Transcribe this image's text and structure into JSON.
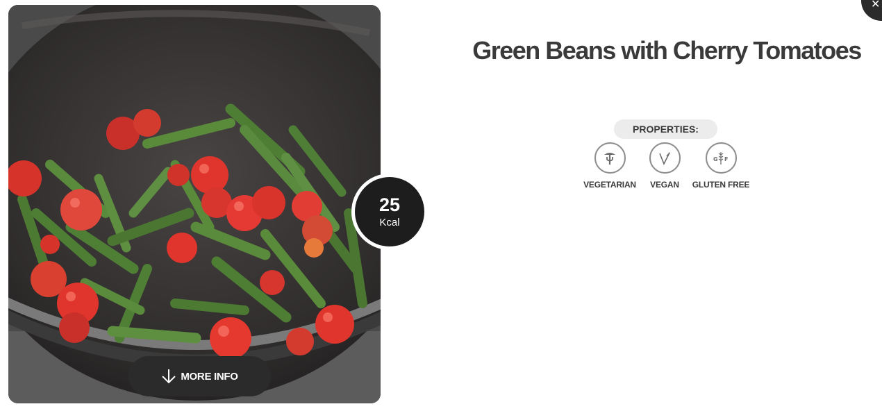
{
  "recipe": {
    "title": "Green Beans with Cherry Tomatoes",
    "image_alt": "Green beans and cherry tomatoes cooking in a pot"
  },
  "nutrition": {
    "kcal_value": "25",
    "kcal_unit": "Kcal"
  },
  "actions": {
    "more_info_label": "MORE INFO",
    "close_icon": "close-icon"
  },
  "properties": {
    "heading": "PROPERTIES:",
    "items": [
      {
        "label": "VEGETARIAN",
        "icon": "vegetarian-icon"
      },
      {
        "label": "VEGAN",
        "icon": "vegan-icon"
      },
      {
        "label": "GLUTEN FREE",
        "icon": "gluten-free-icon"
      }
    ]
  },
  "colors": {
    "dark": "#2b2b2b",
    "title_text": "#3a3a3a",
    "pill_bg": "#ececec",
    "icon_border": "#8d8d8d"
  }
}
